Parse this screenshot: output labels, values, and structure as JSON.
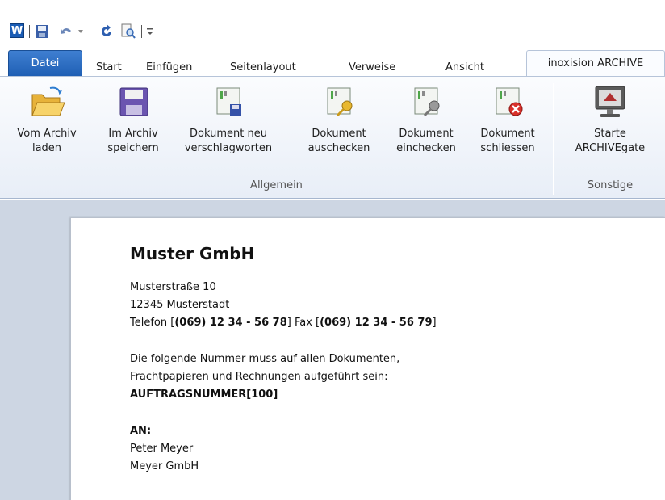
{
  "qat": {
    "word_logo": "W",
    "icons": [
      "word-logo-icon",
      "save-icon",
      "undo-icon",
      "redo-icon",
      "print-preview-icon",
      "customize-icon"
    ]
  },
  "tabs": {
    "file": "Datei",
    "items": [
      "Start",
      "Einfügen",
      "Seitenlayout",
      "Verweise",
      "Ansicht"
    ],
    "active": "inoxision ARCHIVE"
  },
  "ribbon": {
    "buttons": [
      {
        "line1": "Vom Archiv",
        "line2": "laden"
      },
      {
        "line1": "Im Archiv",
        "line2": "speichern"
      },
      {
        "line1": "Dokument neu",
        "line2": "verschlagworten"
      },
      {
        "line1": "Dokument",
        "line2": "auschecken"
      },
      {
        "line1": "Dokument",
        "line2": "einchecken"
      },
      {
        "line1": "Dokument",
        "line2": "schliessen"
      },
      {
        "line1": "Starte",
        "line2": "ARCHIVEgate"
      }
    ],
    "groups": [
      "Allgemein",
      "Sonstige"
    ]
  },
  "document": {
    "company": "Muster GmbH",
    "street": "Musterstraße 10",
    "city": "12345 Musterstadt",
    "phone_label": "Telefon [",
    "phone": "(069) 12 34 - 56 78",
    "fax_label": "] Fax [",
    "fax": "(069) 12 34 - 56 79",
    "fax_close": "]",
    "notice_line1": "Die folgende Nummer muss auf allen Dokumenten,",
    "notice_line2": "Frachtpapieren und Rechnungen aufgeführt sein:",
    "order_number": "AUFTRAGSNUMMER[100]",
    "to_label": "AN:",
    "recipient_name": "Peter Meyer",
    "recipient_company": "Meyer GmbH"
  },
  "colors": {
    "file_tab": "#2a66b8",
    "ribbon_bg": "#eef2f8",
    "doc_bg": "#cdd6e3"
  }
}
